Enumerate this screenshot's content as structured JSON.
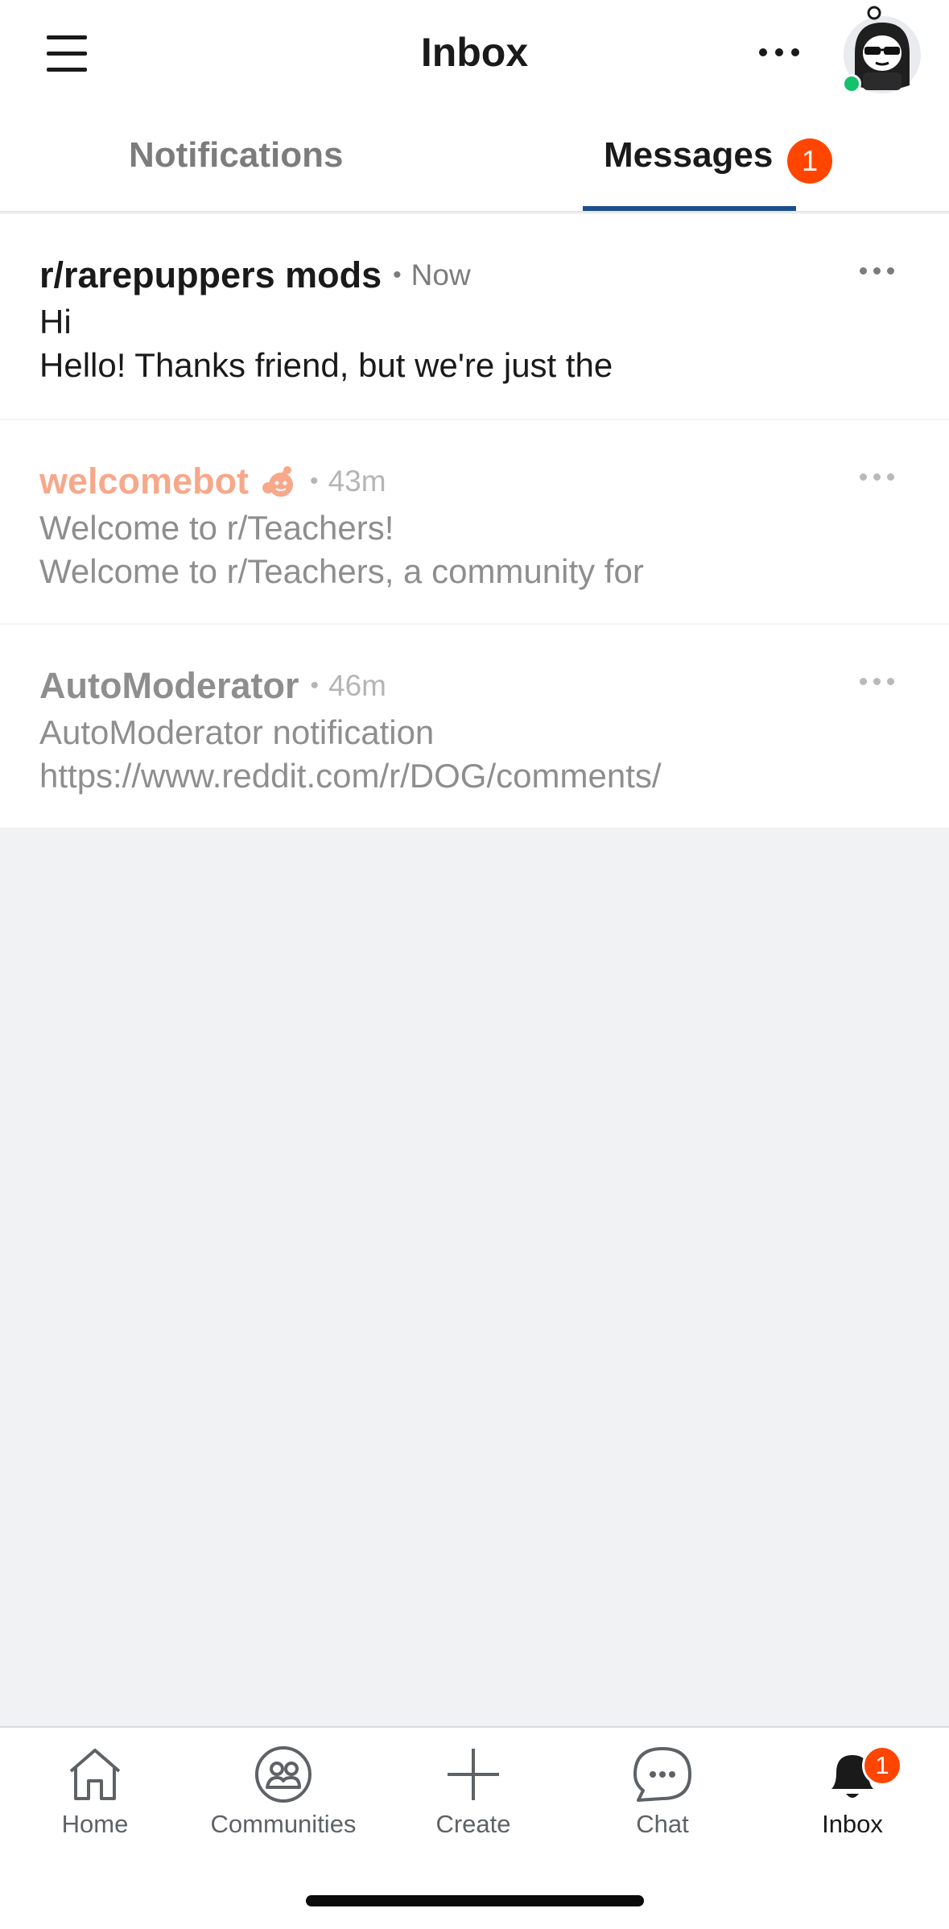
{
  "header": {
    "title": "Inbox",
    "menu_icon": "hamburger-menu-icon",
    "more_icon": "more-horizontal-icon",
    "avatar_icon": "user-avatar-snoo"
  },
  "tabs": [
    {
      "label": "Notifications",
      "active": false
    },
    {
      "label": "Messages",
      "active": true,
      "badge": "1"
    }
  ],
  "messages": [
    {
      "sender": "r/rarepuppers mods",
      "time": "Now",
      "subject": "Hi",
      "preview": "Hello! Thanks friend, but we're just the",
      "unread": true
    },
    {
      "sender": "welcomebot",
      "time": "43m",
      "subject": "Welcome to r/Teachers!",
      "preview": "Welcome to r/Teachers, a community for",
      "unread": false,
      "sender_icon": "reddit-snoo-hand-icon"
    },
    {
      "sender": "AutoModerator",
      "time": "46m",
      "subject": "AutoModerator notification",
      "preview": "https://www.reddit.com/r/DOG/comments/",
      "unread": false
    }
  ],
  "dot_separator": "•",
  "bottom_nav": [
    {
      "label": "Home",
      "icon": "home-icon"
    },
    {
      "label": "Communities",
      "icon": "communities-icon"
    },
    {
      "label": "Create",
      "icon": "plus-icon"
    },
    {
      "label": "Chat",
      "icon": "chat-bubble-icon"
    },
    {
      "label": "Inbox",
      "icon": "bell-icon",
      "badge": "1",
      "active": true
    }
  ],
  "colors": {
    "accent": "#ff4500",
    "tab_underline": "#1c4e8c",
    "online": "#15c26b",
    "bot_name": "#f7a88b"
  }
}
